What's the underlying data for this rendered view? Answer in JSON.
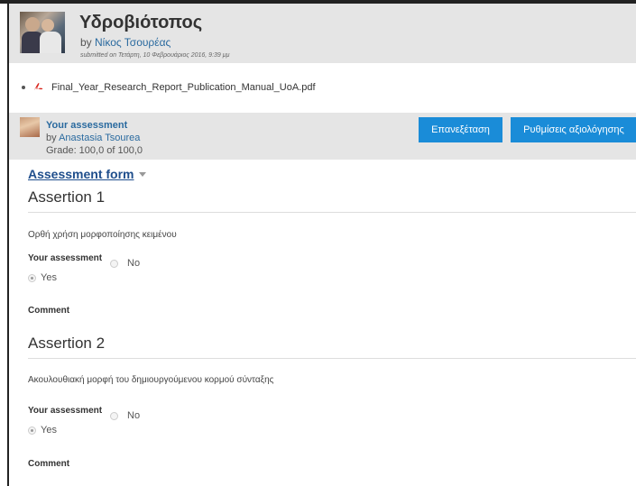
{
  "submission": {
    "title": "Υδροβιότοπος",
    "by_prefix": "by ",
    "author": "Νίκος Τσουρέας",
    "submitted": "submitted on Τετάρτη, 10 Φεβρουάριος 2016, 9:39 μμ"
  },
  "attachment": {
    "filename": "Final_Year_Research_Report_Publication_Manual_UoA.pdf",
    "icon": "pdf-icon"
  },
  "assessment": {
    "title": "Your assessment",
    "by": "by ",
    "assessor": "Anastasia Tsourea",
    "grade": "Grade: 100,0 of 100,0",
    "review_button": "Επανεξέταση",
    "settings_button": "Ρυθμίσεις αξιολόγησης"
  },
  "form": {
    "title": "Assessment form",
    "assertions": [
      {
        "title": "Assertion 1",
        "text": "Ορθή χρήση μορφοποίησης κειμένου",
        "label": "Your assessment",
        "options": [
          "No",
          "Yes"
        ],
        "selected": "Yes",
        "comment_label": "Comment"
      },
      {
        "title": "Assertion 2",
        "text": "Ακουλουθιακή μορφή του δημιουργούμενου κορμού σύνταξης",
        "label": "Your assessment",
        "options": [
          "No",
          "Yes"
        ],
        "selected": "Yes",
        "comment_label": "Comment"
      }
    ]
  },
  "colors": {
    "header_bg": "#e5e5e5",
    "button_bg": "#1a8cd8",
    "link": "#2a6a9f",
    "pdf_red": "#d9251d"
  }
}
